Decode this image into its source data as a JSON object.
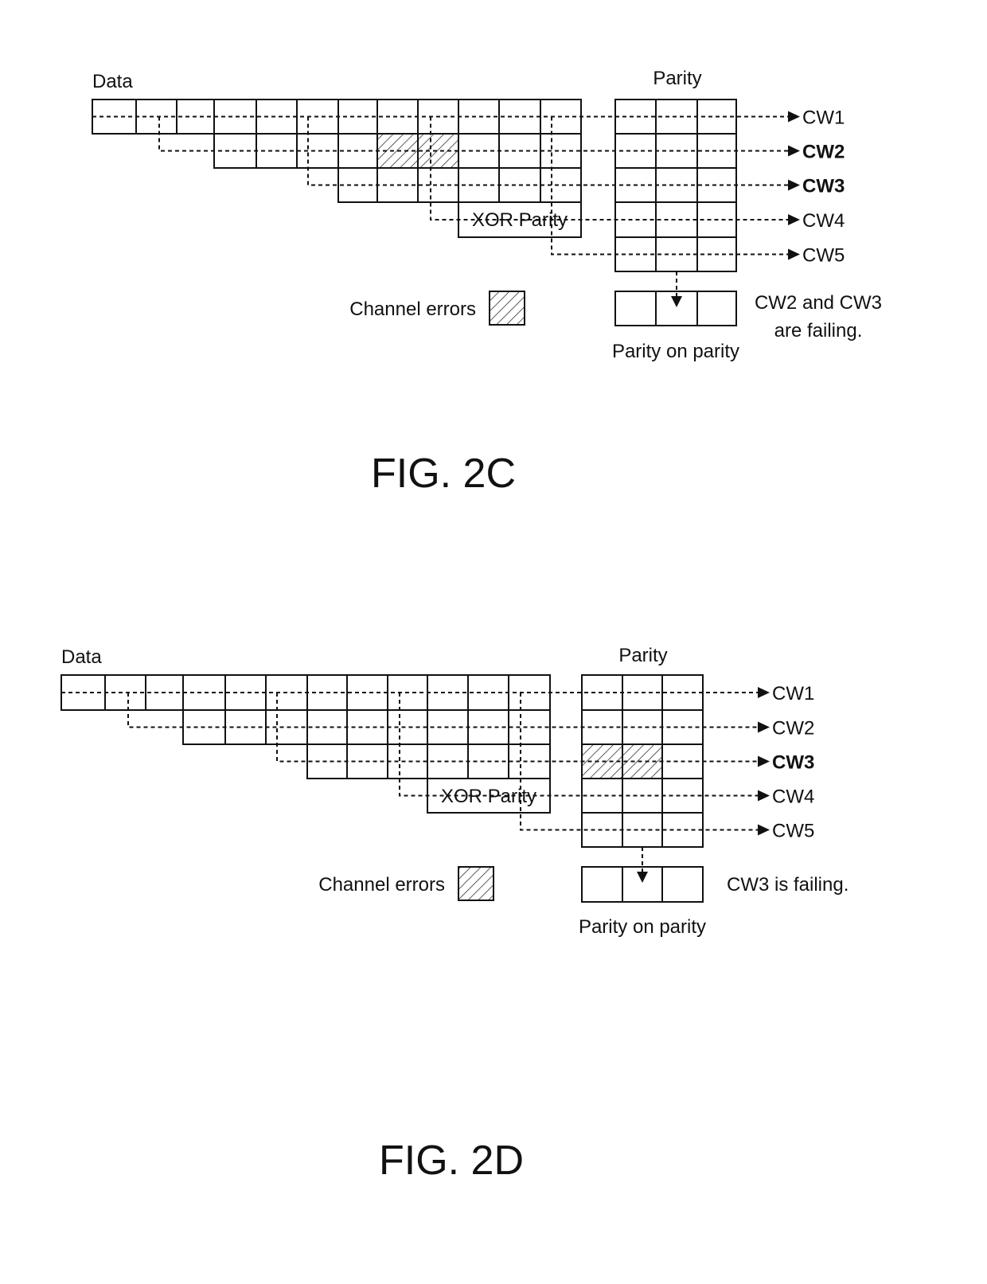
{
  "figures": [
    {
      "id": "2C",
      "caption": "FIG. 2C",
      "data_label": "Data",
      "parity_label": "Parity",
      "xor_parity_label": "XOR Parity",
      "legend_label": "Channel errors",
      "parity_on_parity_label": "Parity on parity",
      "status_lines": [
        "CW2 and CW3",
        "are failing."
      ],
      "codewords": [
        {
          "label": "CW1",
          "bold": false
        },
        {
          "label": "CW2",
          "bold": true
        },
        {
          "label": "CW3",
          "bold": true
        },
        {
          "label": "CW4",
          "bold": false
        },
        {
          "label": "CW5",
          "bold": false
        }
      ],
      "error_location": "data",
      "error_row": 2,
      "error_cols": [
        7,
        8
      ]
    },
    {
      "id": "2D",
      "caption": "FIG. 2D",
      "data_label": "Data",
      "parity_label": "Parity",
      "xor_parity_label": "XOR Parity",
      "legend_label": "Channel errors",
      "parity_on_parity_label": "Parity on parity",
      "status_lines": [
        "CW3 is failing."
      ],
      "codewords": [
        {
          "label": "CW1",
          "bold": false
        },
        {
          "label": "CW2",
          "bold": false
        },
        {
          "label": "CW3",
          "bold": true
        },
        {
          "label": "CW4",
          "bold": false
        },
        {
          "label": "CW5",
          "bold": false
        }
      ],
      "error_location": "parity",
      "error_row": 3,
      "error_cols": [
        1,
        2
      ]
    }
  ]
}
